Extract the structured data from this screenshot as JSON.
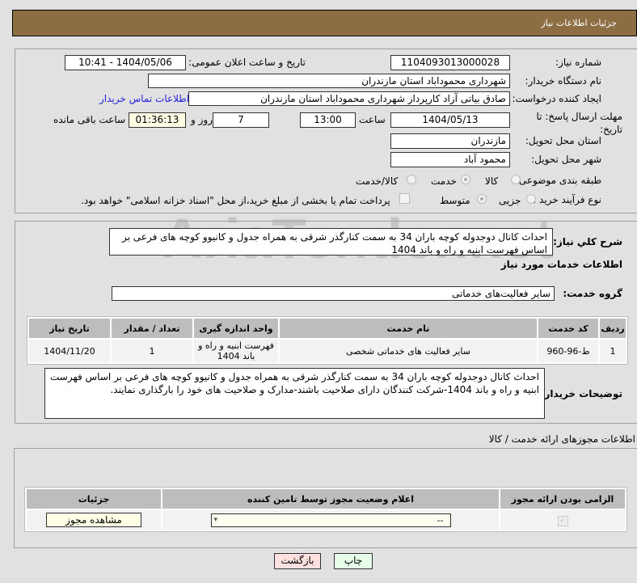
{
  "header": {
    "title": "جزئیات اطلاعات نیاز"
  },
  "fields": {
    "need_number_label": "شماره نیاز:",
    "need_number": "1104093013000028",
    "announce_label": "تاریخ و ساعت اعلان عمومی:",
    "announce_value": "1404/05/06 - 10:41",
    "buyer_label": "نام دستگاه خریدار:",
    "buyer": "شهرداری محموداباد استان مازندران",
    "creator_label": "ایجاد کننده درخواست:",
    "creator": "صادق بیاتی آزاد کارپرداز شهرداری محموداباد استان مازندران",
    "contact_link": "اطلاعات تماس خریدار",
    "deadline_label": "مهلت ارسال پاسخ: تا تاریخ:",
    "deadline_date": "1404/05/13",
    "time_label": "ساعت",
    "deadline_time": "13:00",
    "days": "7",
    "days_label": "روز و",
    "remaining": "01:36:13",
    "remaining_label": "ساعت باقی مانده",
    "province_label": "استان محل تحویل:",
    "province": "مازندران",
    "city_label": "شهر محل تحویل:",
    "city": "محمود آباد",
    "category_label": "طبقه بندی موضوعی:",
    "category_options": [
      "کالا",
      "خدمت",
      "کالا/خدمت"
    ],
    "process_label": "نوع فرآیند خرید :",
    "process_options": [
      "جزیی",
      "متوسط"
    ],
    "payment_note": "پرداخت تمام یا بخشی از مبلغ خرید،از محل \"اسناد خزانه اسلامی\" خواهد بود."
  },
  "description": {
    "label": "شرح کلي نیاز:",
    "text": "احداث کانال دوجدوله کوچه باران 34 به سمت کنارگذر شرقی به همراه جدول و کانیوو کوچه های فرعی بر اساس فهرست ابنیه و راه و باند 1404"
  },
  "services": {
    "heading": "اطلاعات خدمات مورد نیاز",
    "group_label": "گروه خدمت:",
    "group": "سایر فعالیت‌های خدماتی",
    "columns": [
      "ردیف",
      "کد خدمت",
      "نام خدمت",
      "واحد اندازه گیری",
      "تعداد / مقدار",
      "تاریخ نیاز"
    ],
    "rows": [
      [
        "1",
        "ط-96-960",
        "سایر فعالیت های خدماتی شخصی",
        "فهرست ابنیه و راه و باند 1404",
        "1",
        "1404/11/20"
      ]
    ]
  },
  "buyer_notes": {
    "label": "توضیحات خریدار:",
    "text": "احداث کانال دوجدوله کوچه باران 34 به سمت کنارگذر شرقی به همراه جدول و کانیوو کوچه های فرعی بر اساس فهرست ابنیه و راه و باند 1404-شرکت کنندگان دارای صلاحیت باشند-مدارک و صلاحیت های خود را بارگذاری نمایند."
  },
  "permits": {
    "heading": "اطلاعات مجوزهای ارائه خدمت / کالا",
    "columns": [
      "الزامی بودن ارائه مجوز",
      "اعلام وضعیت مجوز توسط تامین کننده",
      "جزئیات"
    ],
    "select_value": "--",
    "view_button": "مشاهده مجوز"
  },
  "buttons": {
    "print": "چاپ",
    "back": "بازگشت"
  },
  "watermark": "AriaTender.net"
}
